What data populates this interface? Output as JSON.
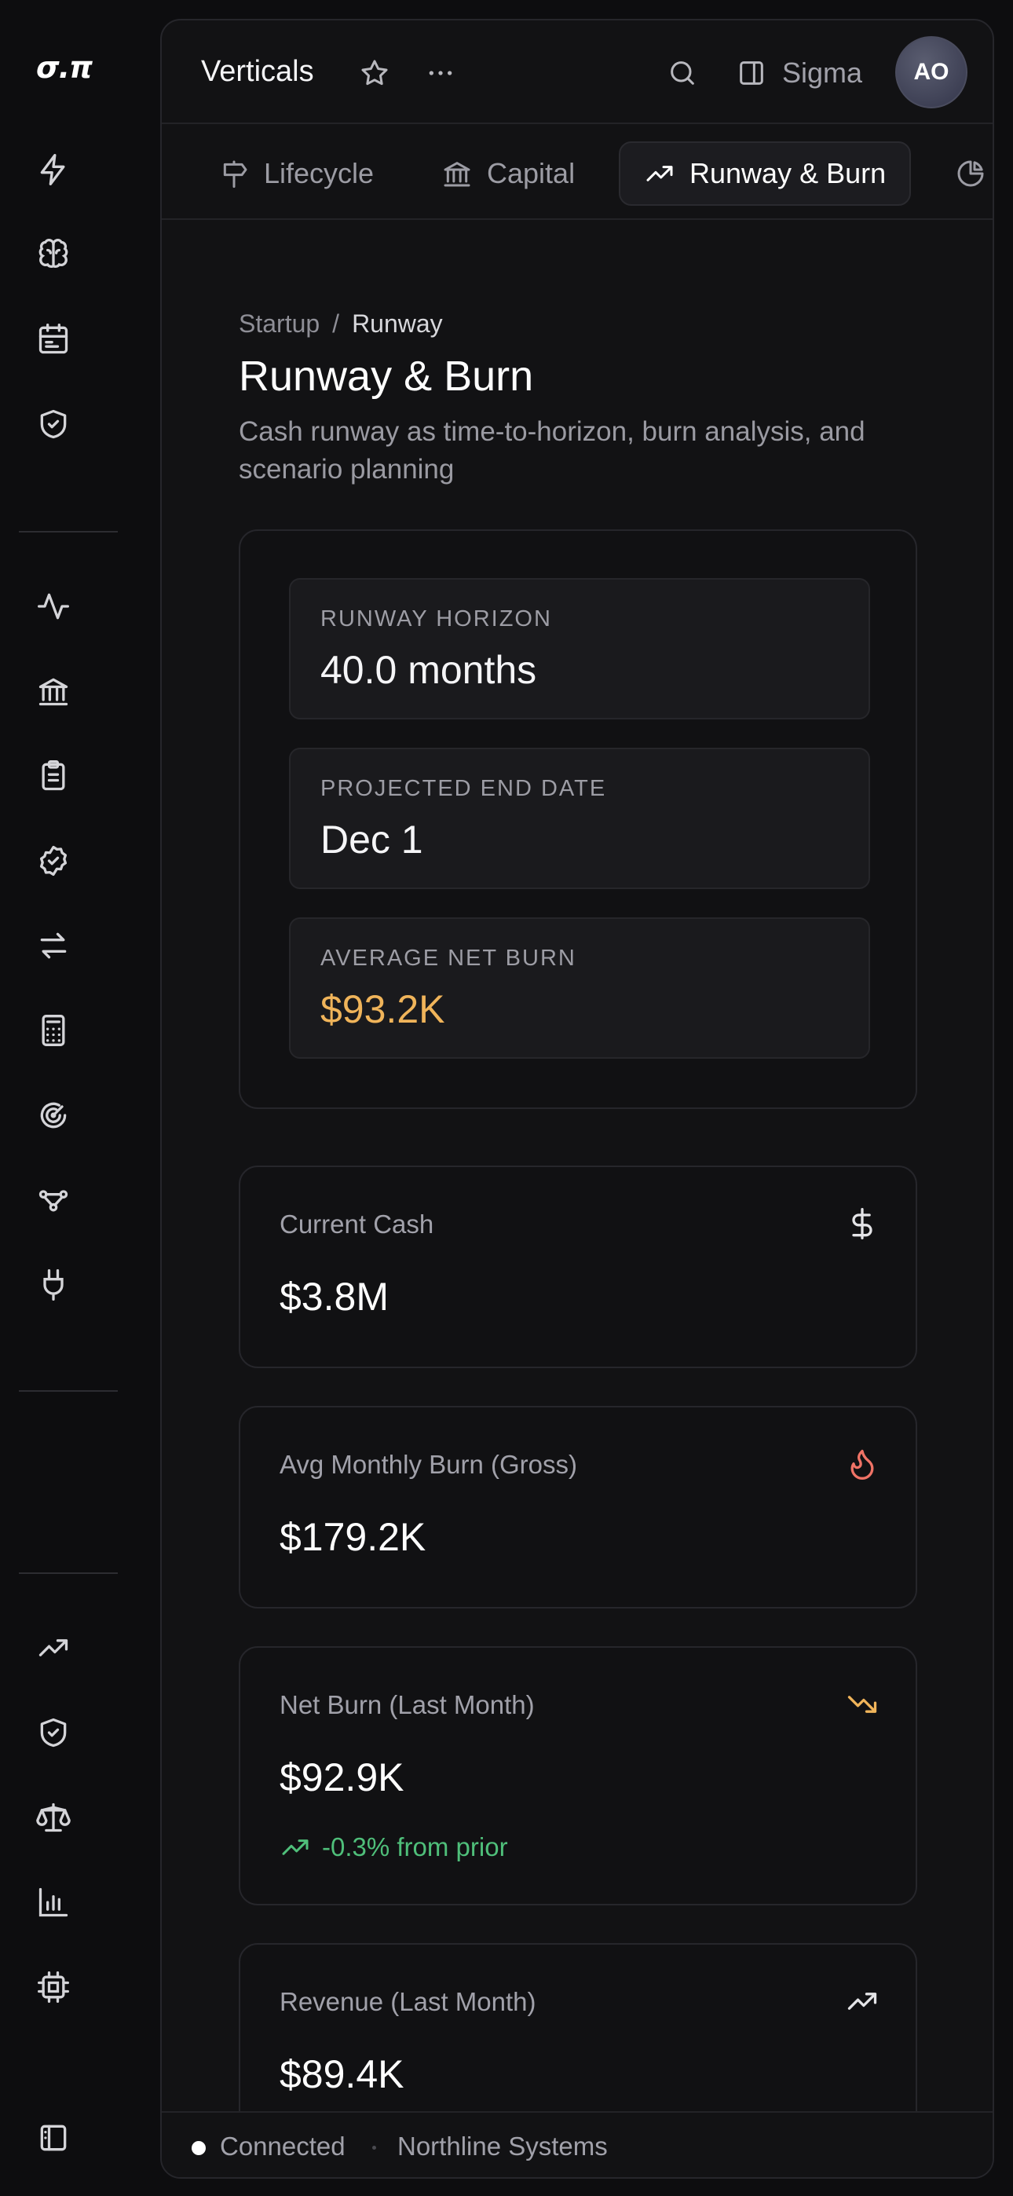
{
  "app": {
    "logo_text": "σ.π"
  },
  "rail": {
    "items_group1": [
      "lightning-icon",
      "brain-icon",
      "calendar-icon",
      "shield-check-icon"
    ],
    "items_group2": [
      "activity-icon",
      "bank-icon",
      "clipboard-icon",
      "badge-check-icon",
      "arrows-left-right-icon",
      "calculator-icon",
      "radar-icon",
      "workflow-icon",
      "plug-icon"
    ],
    "items_group3": [
      "trending-up-icon",
      "shield-check-icon",
      "scale-icon",
      "bar-chart-icon",
      "cpu-icon"
    ],
    "footer_icon": "panel-icon"
  },
  "header": {
    "title": "Verticals",
    "sigma_label": "Sigma",
    "avatar_initials": "AO"
  },
  "tabs": [
    {
      "label": "Lifecycle",
      "icon": "signpost-icon",
      "active": false
    },
    {
      "label": "Capital",
      "icon": "bank-icon",
      "active": false
    },
    {
      "label": "Runway & Burn",
      "icon": "trending-up-icon",
      "active": true
    },
    {
      "label": "",
      "icon": "pie-chart-icon",
      "active": false
    }
  ],
  "page": {
    "breadcrumb_root": "Startup",
    "breadcrumb_sep": "/",
    "breadcrumb_current": "Runway",
    "title": "Runway & Burn",
    "subtitle": "Cash runway as time-to-horizon, burn analysis, and scenario planning"
  },
  "horizon": {
    "runway_label": "RUNWAY HORIZON",
    "runway_value": "40.0 months",
    "end_label": "PROJECTED END DATE",
    "end_value": "Dec 1",
    "burn_label": "AVERAGE NET BURN",
    "burn_value": "$93.2K"
  },
  "stats": {
    "cash": {
      "label": "Current Cash",
      "value": "$3.8M",
      "icon": "dollar-icon"
    },
    "gross": {
      "label": "Avg Monthly Burn (Gross)",
      "value": "$179.2K",
      "icon": "flame-icon"
    },
    "net": {
      "label": "Net Burn (Last Month)",
      "value": "$92.9K",
      "delta": "-0.3% from prior",
      "icon": "trending-down-icon"
    },
    "revenue": {
      "label": "Revenue (Last Month)",
      "value": "$89.4K",
      "icon": "trending-up-icon"
    }
  },
  "status": {
    "connection": "Connected",
    "org": "Northline Systems"
  },
  "colors": {
    "accent_amber": "#f0b45a",
    "positive_green": "#4fbf7a",
    "flame_red": "#f07366",
    "background": "#0d0d0f"
  }
}
